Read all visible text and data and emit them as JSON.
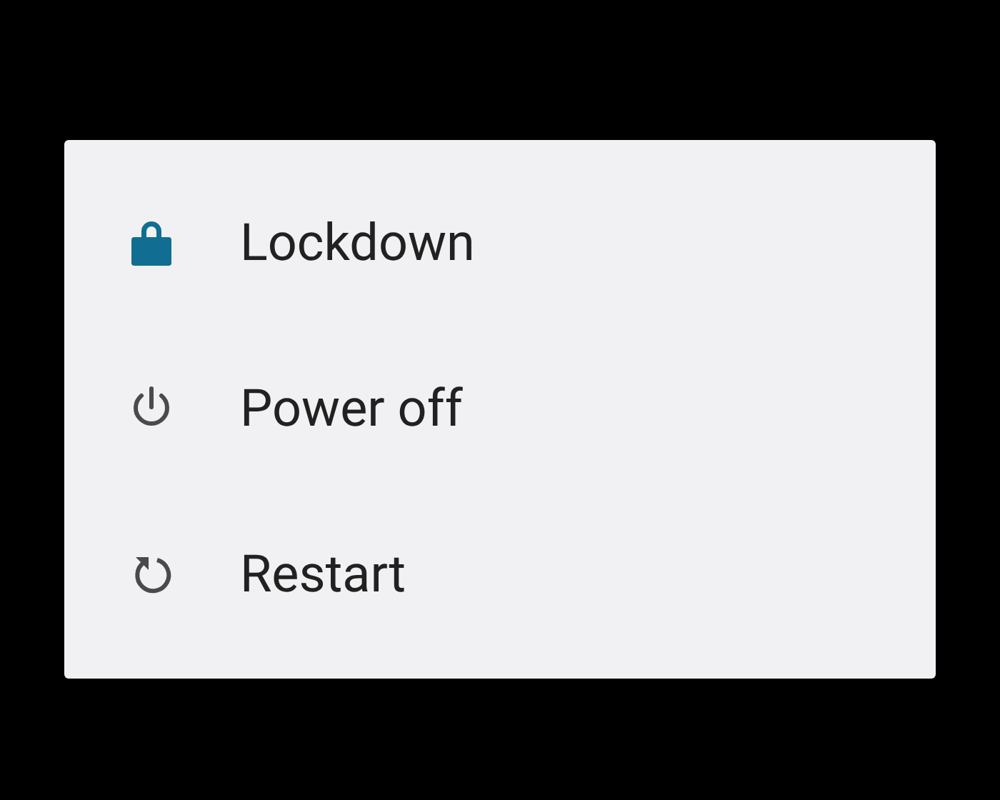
{
  "menu": {
    "items": [
      {
        "kind": "lock",
        "label": "Lockdown",
        "color": "#116e92"
      },
      {
        "kind": "power",
        "label": "Power off",
        "color": "#4a4a4a"
      },
      {
        "kind": "restart",
        "label": "Restart",
        "color": "#4a4a4a"
      }
    ]
  }
}
